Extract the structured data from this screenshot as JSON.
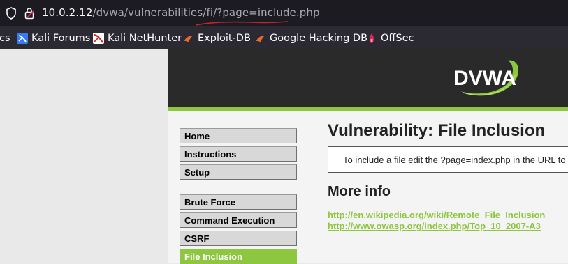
{
  "browser": {
    "url_host": "10.0.2.12",
    "url_path": "/dvwa/vulnerabilities/fi/?page=include.php",
    "bookmarks": [
      {
        "label": "cs",
        "icon": "truncated"
      },
      {
        "label": "Kali Forums",
        "icon": "kali-forums-icon"
      },
      {
        "label": "Kali NetHunter",
        "icon": "kali-nethunter-icon"
      },
      {
        "label": "Exploit-DB",
        "icon": "exploit-db-icon"
      },
      {
        "label": "Google Hacking DB",
        "icon": "ghdb-icon"
      },
      {
        "label": "OffSec",
        "icon": "offsec-icon"
      }
    ]
  },
  "header": {
    "logo_text": "DVWA"
  },
  "menu": {
    "items": [
      {
        "label": "Home"
      },
      {
        "label": "Instructions"
      },
      {
        "label": "Setup"
      },
      {
        "label": "Brute Force"
      },
      {
        "label": "Command Execution"
      },
      {
        "label": "CSRF"
      },
      {
        "label": "File Inclusion",
        "active": true
      }
    ]
  },
  "main": {
    "title": "Vulnerability: File Inclusion",
    "info_text": "To include a file edit the ?page=index.php in the URL to",
    "more_info_heading": "More info",
    "links": [
      "http://en.wikipedia.org/wiki/Remote_File_Inclusion",
      "http://www.owasp.org/index.php/Top_10_2007-A3"
    ]
  },
  "colors": {
    "accent_green": "#8dc63f",
    "header_bg": "#2a2a2a",
    "browser_bg": "#1c1b22",
    "annotation_red": "#c0262b"
  }
}
